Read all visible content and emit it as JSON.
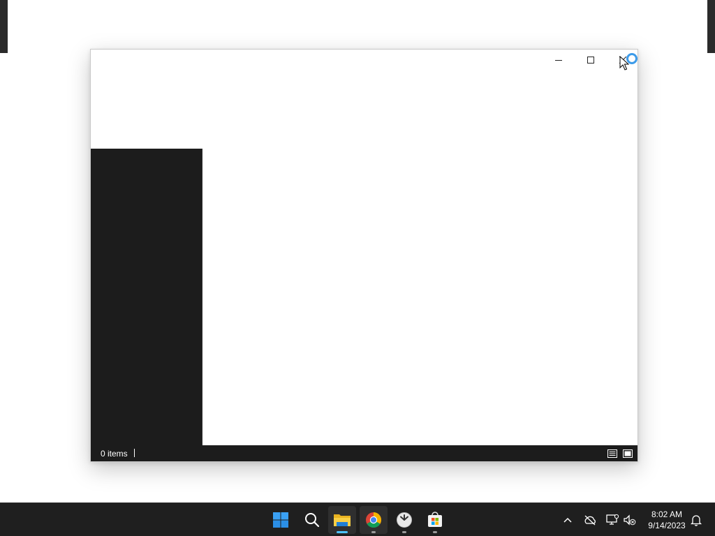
{
  "window": {
    "controls": {
      "minimize": "minimize",
      "maximize": "maximize",
      "close": "close"
    },
    "status_bar": {
      "item_count": "0 items"
    }
  },
  "taskbar": {
    "apps": [
      {
        "name": "start",
        "icon": "windows-logo-icon"
      },
      {
        "name": "search",
        "icon": "search-icon"
      },
      {
        "name": "file-explorer",
        "icon": "folder-icon",
        "active": true
      },
      {
        "name": "chrome",
        "icon": "chrome-icon",
        "active": true
      },
      {
        "name": "clock-app",
        "icon": "clock-icon"
      },
      {
        "name": "microsoft-store",
        "icon": "store-icon"
      }
    ],
    "tray": {
      "icons": [
        "chevron-up-icon",
        "cloud-offline-icon",
        "network-icon",
        "volume-muted-icon",
        "notification-icon"
      ],
      "time": "8:02 AM",
      "date": "9/14/2023"
    }
  },
  "colors": {
    "accent": "#4cc2ff",
    "dark_pane": "#1c1c1c",
    "taskbar": "#1f1f1f"
  }
}
